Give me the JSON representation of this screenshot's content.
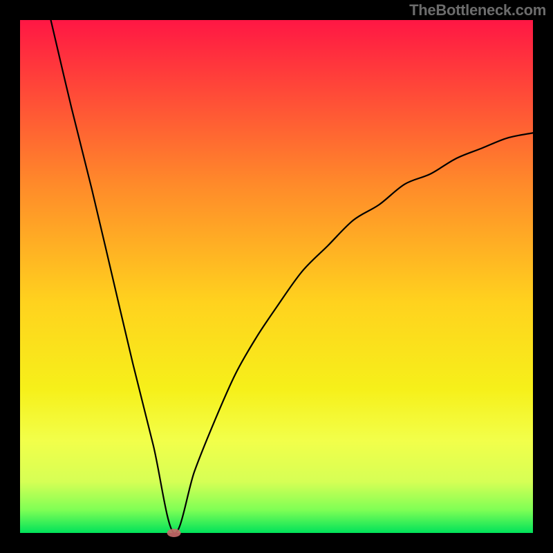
{
  "watermark": "TheBottleneck.com",
  "chart_data": {
    "type": "line",
    "title": "",
    "xlabel": "",
    "ylabel": "",
    "xlim": [
      0,
      100
    ],
    "ylim": [
      0,
      100
    ],
    "notes": "Bottleneck/mismatch curve on a red→green vertical gradient background. Optimum (minimum) marked near x≈30 at y≈0. Left branch is roughly linear down from (6,100) to (30,0); right branch is concave rising from (30,0) toward ~(100,78).",
    "series": [
      {
        "name": "bottleneck-curve",
        "x": [
          6,
          10,
          14,
          18,
          22,
          26,
          30,
          34,
          38,
          42,
          46,
          50,
          55,
          60,
          65,
          70,
          75,
          80,
          85,
          90,
          95,
          100
        ],
        "y": [
          100,
          83,
          67,
          50,
          33,
          17,
          0,
          12,
          22,
          31,
          38,
          44,
          51,
          56,
          61,
          64,
          68,
          70,
          73,
          75,
          77,
          78
        ]
      }
    ],
    "marker": {
      "x": 30,
      "y": 0,
      "color": "#c86a6a",
      "rx": 10,
      "ry": 6
    },
    "frame": {
      "inner_x": 29,
      "inner_y": 29,
      "inner_w": 742,
      "inner_h": 742,
      "border": 29
    },
    "gradient_stops": [
      {
        "offset": 0.0,
        "color": "#ff1744"
      },
      {
        "offset": 0.1,
        "color": "#ff3b3b"
      },
      {
        "offset": 0.32,
        "color": "#ff8a2a"
      },
      {
        "offset": 0.55,
        "color": "#ffd21e"
      },
      {
        "offset": 0.72,
        "color": "#f6f01a"
      },
      {
        "offset": 0.82,
        "color": "#f2ff4a"
      },
      {
        "offset": 0.9,
        "color": "#d6ff55"
      },
      {
        "offset": 0.955,
        "color": "#7fff55"
      },
      {
        "offset": 1.0,
        "color": "#00e25a"
      }
    ]
  }
}
